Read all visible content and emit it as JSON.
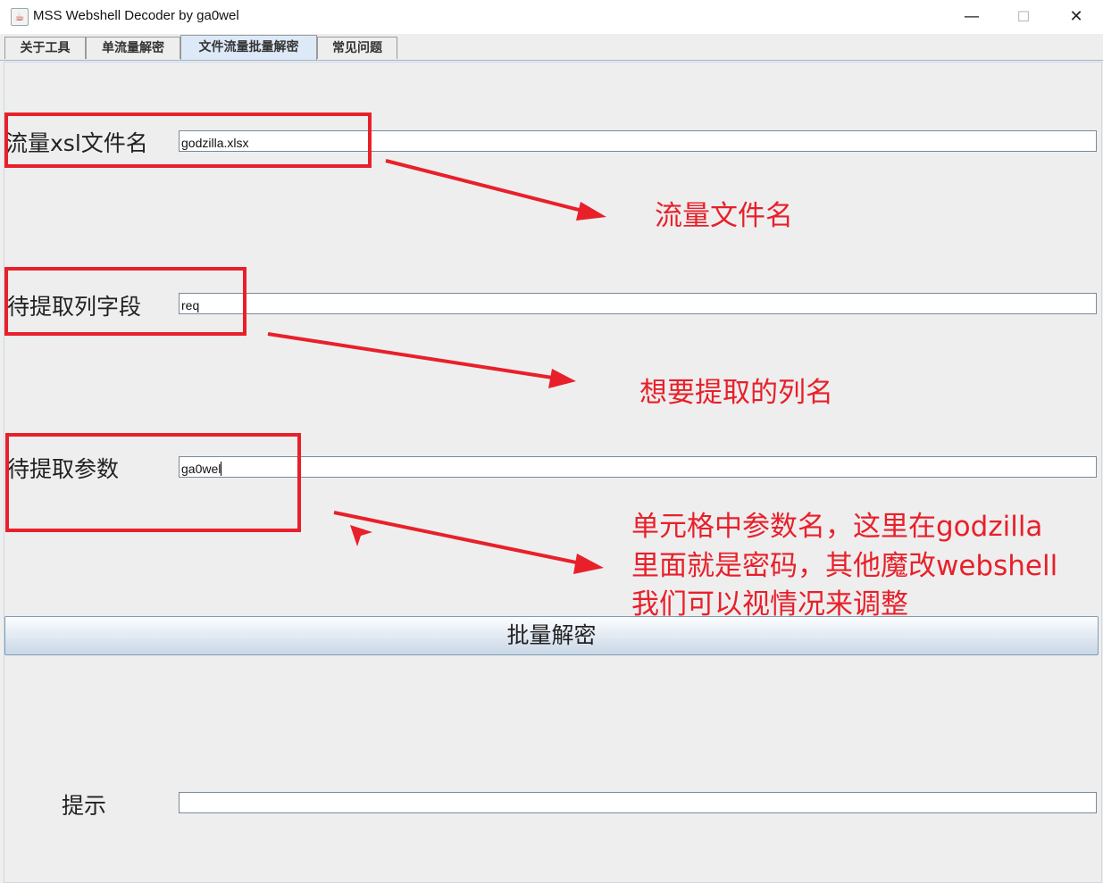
{
  "window": {
    "title": "MSS Webshell Decoder by ga0wel",
    "minimize_glyph": "—",
    "maximize_glyph": "☐",
    "close_glyph": "✕",
    "app_icon": "java-cup-icon"
  },
  "tabs": [
    {
      "label": "关于工具",
      "active": false
    },
    {
      "label": "单流量解密",
      "active": false
    },
    {
      "label": "文件流量批量解密",
      "active": true
    },
    {
      "label": "常见问题",
      "active": false
    }
  ],
  "form": {
    "filename_label": "流量xsl文件名",
    "filename_value": "godzilla.xlsx",
    "column_label": "待提取列字段",
    "column_value": "req",
    "param_label": "待提取参数",
    "param_value": "ga0wel",
    "decrypt_button": "批量解密",
    "hint_label": "提示",
    "hint_value": ""
  },
  "annotations": {
    "note_filename": "流量文件名",
    "note_column": "想要提取的列名",
    "note_param_lines": [
      "单元格中参数名，这里在godzilla",
      "里面就是密码，其他魔改webshell",
      "我们可以视情况来调整"
    ],
    "color": "#e8202a"
  }
}
